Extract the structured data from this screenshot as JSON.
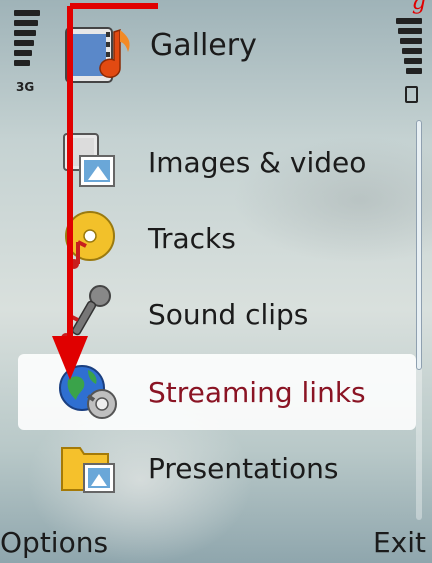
{
  "annotation": {
    "text": "g"
  },
  "status": {
    "network": "3G",
    "battery_icon": "battery-icon",
    "signal_icon": "signal-icon"
  },
  "header": {
    "title": "Gallery",
    "icon": "gallery-film-music-icon"
  },
  "menu": {
    "items": [
      {
        "label": "Images & video",
        "icon": "images-video-icon",
        "selected": false
      },
      {
        "label": "Tracks",
        "icon": "tracks-icon",
        "selected": false
      },
      {
        "label": "Sound clips",
        "icon": "sound-clips-icon",
        "selected": false
      },
      {
        "label": "Streaming links",
        "icon": "streaming-links-icon",
        "selected": true
      },
      {
        "label": "Presentations",
        "icon": "presentations-icon",
        "selected": false
      }
    ]
  },
  "softkeys": {
    "left": "Options",
    "right": "Exit"
  },
  "colors": {
    "selected_text": "#8a1424",
    "arrow": "#e00000"
  }
}
